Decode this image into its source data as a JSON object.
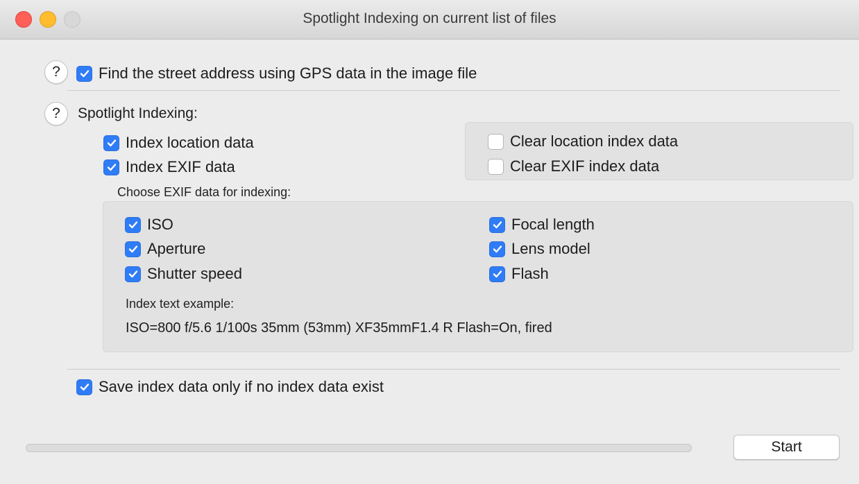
{
  "window": {
    "title": "Spotlight Indexing on current list of files"
  },
  "help_symbol": "?",
  "gps": {
    "label": "Find the street address using GPS data in the image file",
    "checked": true
  },
  "spotlight": {
    "heading": "Spotlight Indexing:",
    "index_location": {
      "label": "Index location data",
      "checked": true
    },
    "index_exif": {
      "label": "Index EXIF data",
      "checked": true
    },
    "clear_location": {
      "label": "Clear location index data",
      "checked": false
    },
    "clear_exif": {
      "label": "Clear EXIF index data",
      "checked": false
    }
  },
  "exif": {
    "heading": "Choose EXIF data for indexing:",
    "iso": {
      "label": "ISO",
      "checked": true
    },
    "aperture": {
      "label": "Aperture",
      "checked": true
    },
    "shutter": {
      "label": "Shutter speed",
      "checked": true
    },
    "focal": {
      "label": "Focal length",
      "checked": true
    },
    "lens": {
      "label": "Lens model",
      "checked": true
    },
    "flash": {
      "label": "Flash",
      "checked": true
    },
    "example_heading": "Index text example:",
    "example_text": "ISO=800 f/5.6 1/100s 35mm (53mm) XF35mmF1.4 R Flash=On, fired"
  },
  "save_only": {
    "label": "Save index data only if no index data exist",
    "checked": true
  },
  "progress": {
    "value": 0
  },
  "start_button": {
    "label": "Start"
  },
  "colors": {
    "accent": "#2f7cf6",
    "close": "#fe5f57",
    "minimize": "#febc2e",
    "zoom_disabled": "#d8d8d8"
  }
}
